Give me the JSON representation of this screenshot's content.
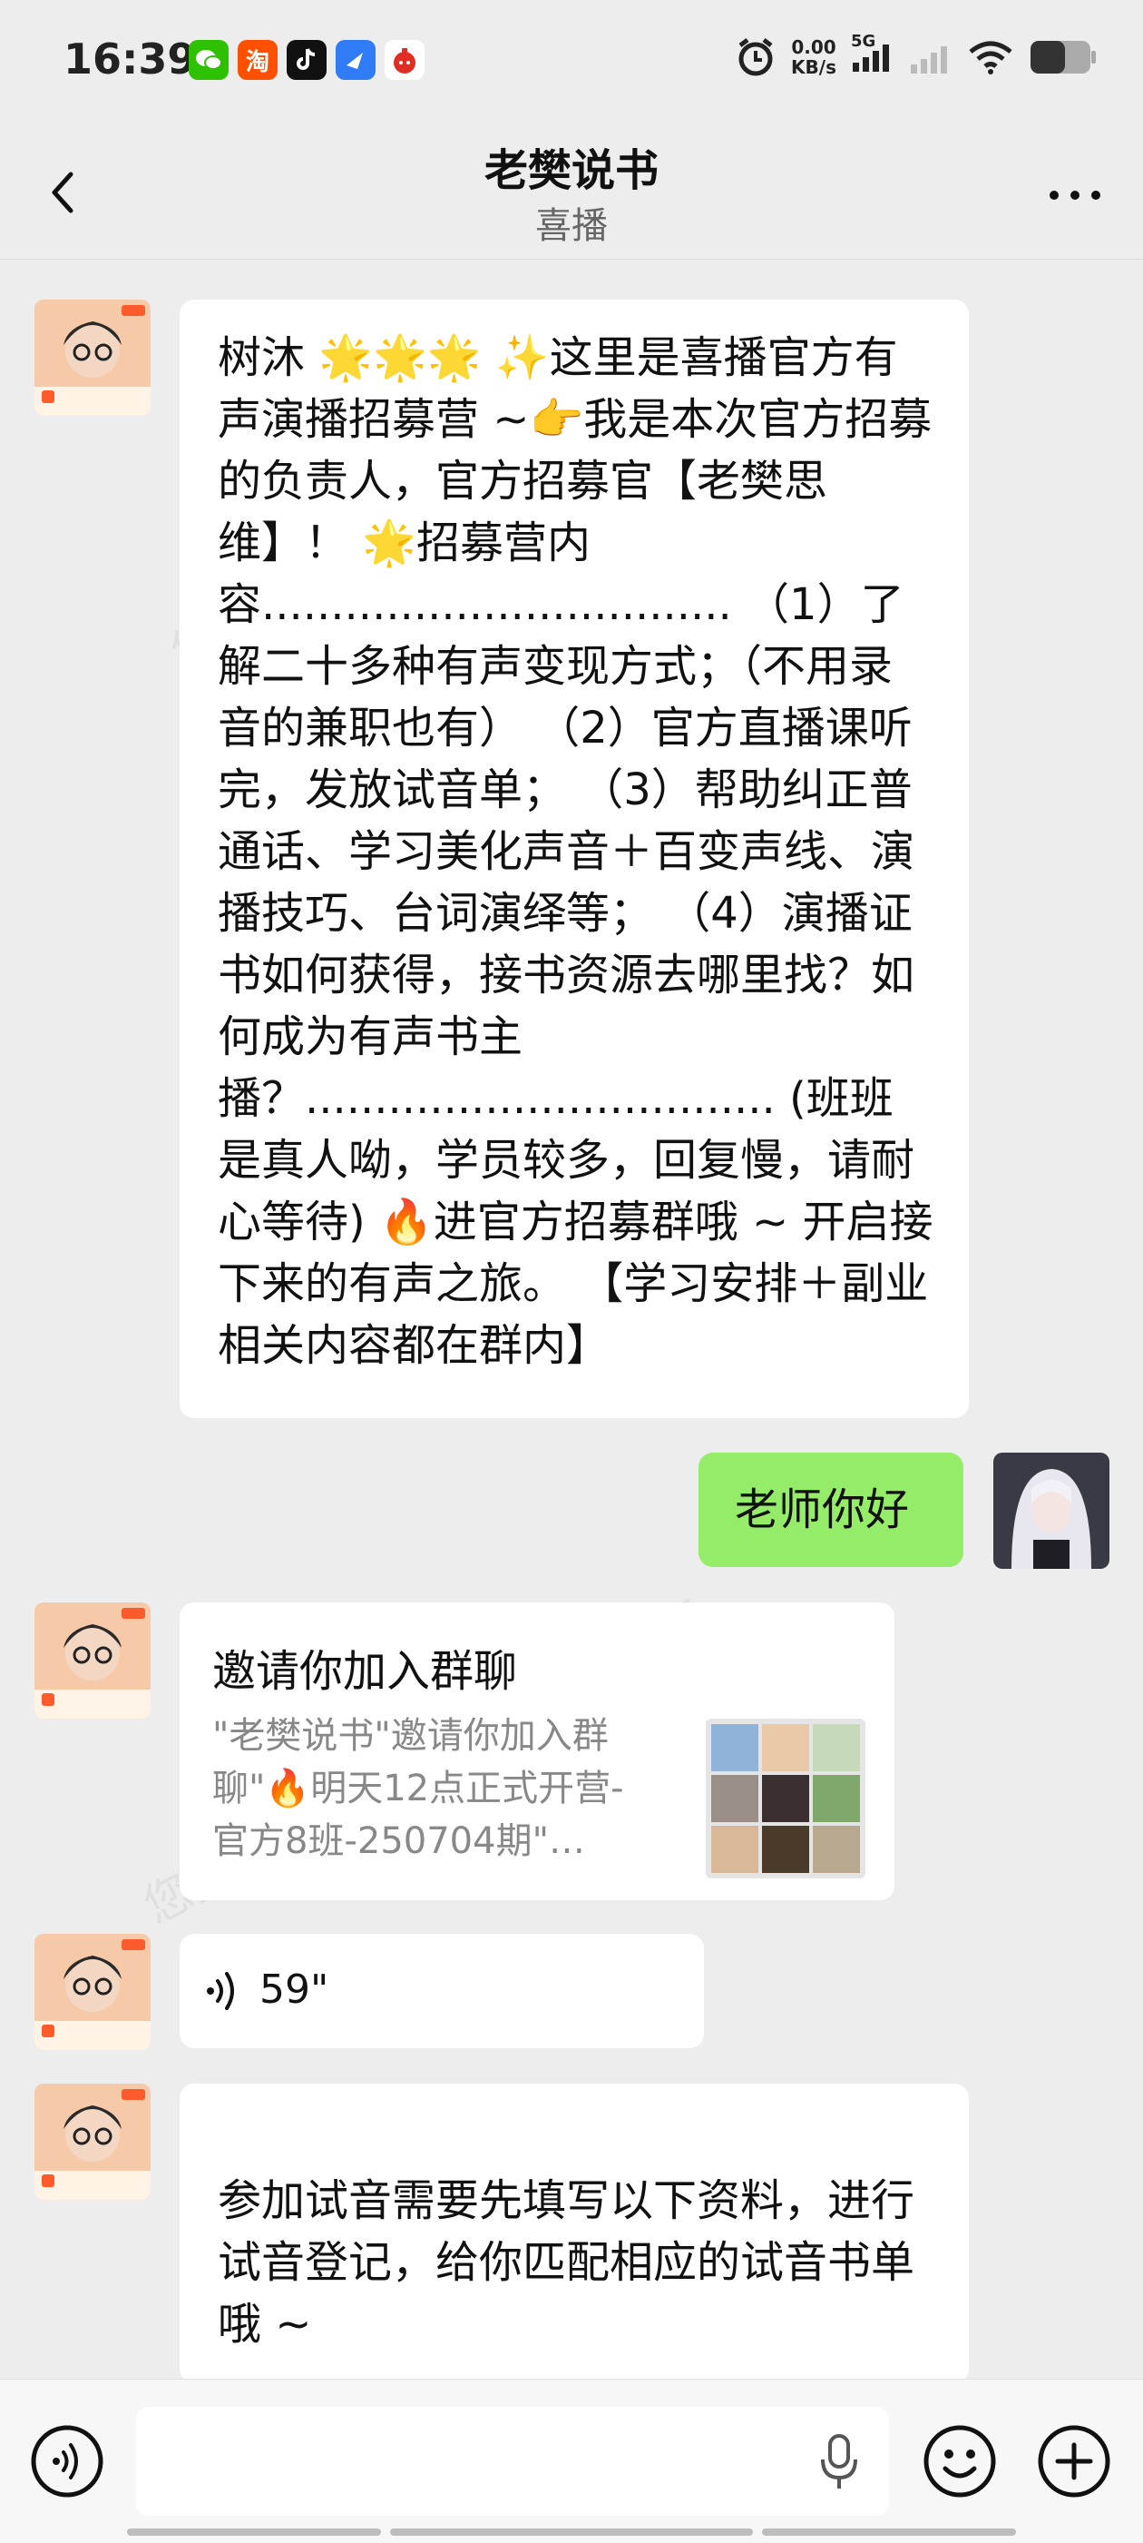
{
  "status_bar": {
    "time": "16:39",
    "speed_value": "0.00",
    "speed_unit": "KB/s",
    "network": "5G",
    "app_icons": [
      "wechat-icon",
      "taobao-icon",
      "tiktok-icon",
      "browser-icon",
      "pinduoduo-icon"
    ],
    "taobao_glyph": "淘"
  },
  "header": {
    "title": "老樊说书",
    "subtitle": "喜播"
  },
  "messages": [
    {
      "sender": "other",
      "type": "text",
      "text": " 树沐  🌟🌟🌟 ✨这里是喜播官方有声演播招募营 ~👉我是本次官方招募的负责人，官方招募官【老樊思维】！  🌟招募营内容.................................. （1）了解二十多种有声变现方式；（不用录音的兼职也有）  （2）官方直播课听完，发放试音单；  （3）帮助纠正普通话、学习美化声音＋百变声线、演播技巧、台词演绎等； （4）演播证书如何获得，接书资源去哪里找？如何成为有声书主播？.................................. (班班是真人呦，学员较多，回复慢，请耐心等待) 🔥进官方招募群哦 ~ 开启接下来的有声之旅。 【学习安排＋副业相关内容都在群内】"
    },
    {
      "sender": "me",
      "type": "text",
      "text": "老师你好"
    },
    {
      "sender": "other",
      "type": "group_invite",
      "title": "邀请你加入群聊",
      "description": "\"老樊说书\"邀请你加入群聊\"🔥明天12点正式开营-官方8班-250704期\"…"
    },
    {
      "sender": "other",
      "type": "voice",
      "duration": "59\""
    },
    {
      "sender": "other",
      "type": "text",
      "text": "参加试音需要先填写以下资料，进行试音登记，给你匹配相应的试音书单哦 ~"
    }
  ],
  "watermark_text": "您身边的消费服务管家 消费保",
  "colors": {
    "background": "#ededed",
    "my_bubble": "#95ec69",
    "other_bubble": "#ffffff"
  }
}
